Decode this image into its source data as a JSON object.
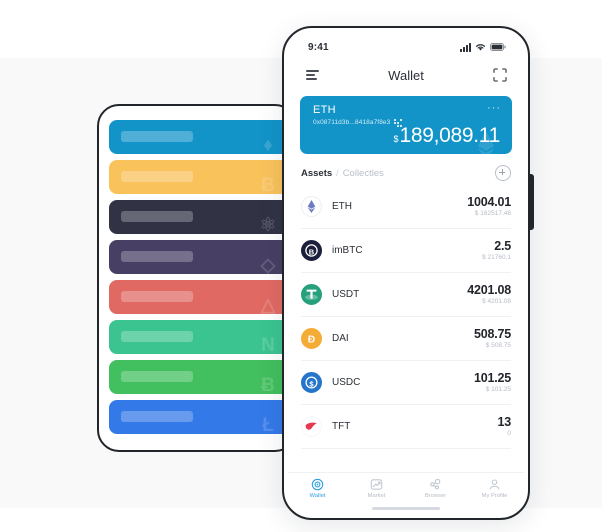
{
  "background": {
    "page_bg": "#f9f9fa",
    "band_bg": "#ffffff"
  },
  "back_phone": {
    "name": "loading-skeleton-phone",
    "cards": [
      {
        "color": "#1294c8",
        "glyph": "♦",
        "icon_name": "ethereum-icon"
      },
      {
        "color": "#f9c25b",
        "glyph": "Ƀ",
        "icon_name": "bitcoin-icon"
      },
      {
        "color": "#313345",
        "glyph": "⚛",
        "icon_name": "cosmos-atom-icon"
      },
      {
        "color": "#483f64",
        "glyph": "◇",
        "icon_name": "eos-icon"
      },
      {
        "color": "#e06a63",
        "glyph": "△",
        "icon_name": "tron-icon"
      },
      {
        "color": "#3bc490",
        "glyph": "N",
        "icon_name": "nano-icon"
      },
      {
        "color": "#42bf5f",
        "glyph": "Ƀ",
        "icon_name": "bitcoin-cash-icon"
      },
      {
        "color": "#3479e8",
        "glyph": "Ł",
        "icon_name": "litecoin-icon"
      }
    ]
  },
  "status_bar": {
    "time": "9:41",
    "signal_icon": "cellular-signal-icon",
    "wifi_icon": "wifi-icon",
    "battery_icon": "battery-icon"
  },
  "header": {
    "menu_icon": "hamburger-menu-icon",
    "title": "Wallet",
    "scan_icon": "scan-qr-icon"
  },
  "balance_card": {
    "accent_color": "#1294c8",
    "symbol": "ETH",
    "address": "0x08711d3b...8418a7f8e3",
    "qr_icon": "qr-code-icon",
    "more_icon": "more-options-icon",
    "more_label": "···",
    "currency_symbol": "$",
    "amount": "189,089.11"
  },
  "assets_section": {
    "tab_assets": "Assets",
    "tab_separator": "/",
    "tab_collectibles": "Collectles",
    "add_button_icon": "add-asset-icon"
  },
  "assets": [
    {
      "name": "ETH",
      "amount": "1004.01",
      "fiat": "$ 162517.48",
      "icon_name": "ethereum-icon",
      "icon_bg": "#ffffff",
      "icon_border": "#eceef2",
      "icon_color": "#6c7bc4"
    },
    {
      "name": "imBTC",
      "amount": "2.5",
      "fiat": "$ 21760.1",
      "icon_name": "imbtc-icon",
      "icon_bg": "#1b1f3b",
      "icon_border": "#1b1f3b",
      "icon_color": "#ffffff"
    },
    {
      "name": "USDT",
      "amount": "4201.08",
      "fiat": "$ 4201.08",
      "icon_name": "tether-icon",
      "icon_bg": "#26a17b",
      "icon_border": "#26a17b",
      "icon_color": "#ffffff"
    },
    {
      "name": "DAI",
      "amount": "508.75",
      "fiat": "$ 508.75",
      "icon_name": "dai-icon",
      "icon_bg": "#f5ac37",
      "icon_border": "#f5ac37",
      "icon_color": "#ffffff"
    },
    {
      "name": "USDC",
      "amount": "101.25",
      "fiat": "$ 101.25",
      "icon_name": "usdc-icon",
      "icon_bg": "#2775ca",
      "icon_border": "#2775ca",
      "icon_color": "#ffffff"
    },
    {
      "name": "TFT",
      "amount": "13",
      "fiat": "0",
      "icon_name": "tft-icon",
      "icon_bg": "#ffffff",
      "icon_border": "#f4f5f7",
      "icon_color": "#e8384f"
    }
  ],
  "bottom_nav": {
    "active_color": "#2f9fe0",
    "items": [
      {
        "label": "Wallet",
        "icon_name": "wallet-icon",
        "active": true
      },
      {
        "label": "Market",
        "icon_name": "market-chart-icon",
        "active": false
      },
      {
        "label": "Browser",
        "icon_name": "browser-nodes-icon",
        "active": false
      },
      {
        "label": "My Profile",
        "icon_name": "user-profile-icon",
        "active": false
      }
    ]
  }
}
